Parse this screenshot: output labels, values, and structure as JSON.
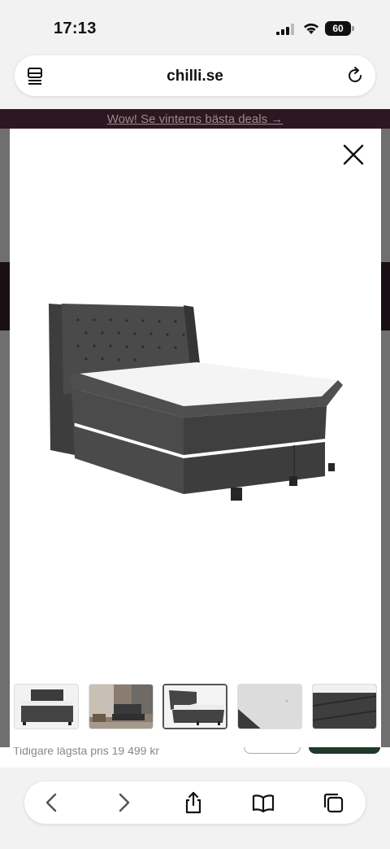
{
  "status_bar": {
    "time": "17:13",
    "battery": "60"
  },
  "browser": {
    "domain": "chilli.se"
  },
  "promo": {
    "text": "Wow! Se vinterns bästa deals →"
  },
  "page": {
    "previous_price": "Tidigare lägsta pris 19 499 kr"
  },
  "gallery": {
    "close_icon": "close-icon",
    "selected_index": 2,
    "thumbnails": [
      {
        "name": "bed-front-thumbnail"
      },
      {
        "name": "bedroom-scene-thumbnail"
      },
      {
        "name": "bed-angle-thumbnail"
      },
      {
        "name": "fabric-detail-thumbnail"
      },
      {
        "name": "mattress-edge-thumbnail"
      }
    ]
  },
  "toolbar": {
    "buttons": [
      "back-icon",
      "forward-icon",
      "share-icon",
      "bookmarks-icon",
      "tabs-icon"
    ]
  }
}
